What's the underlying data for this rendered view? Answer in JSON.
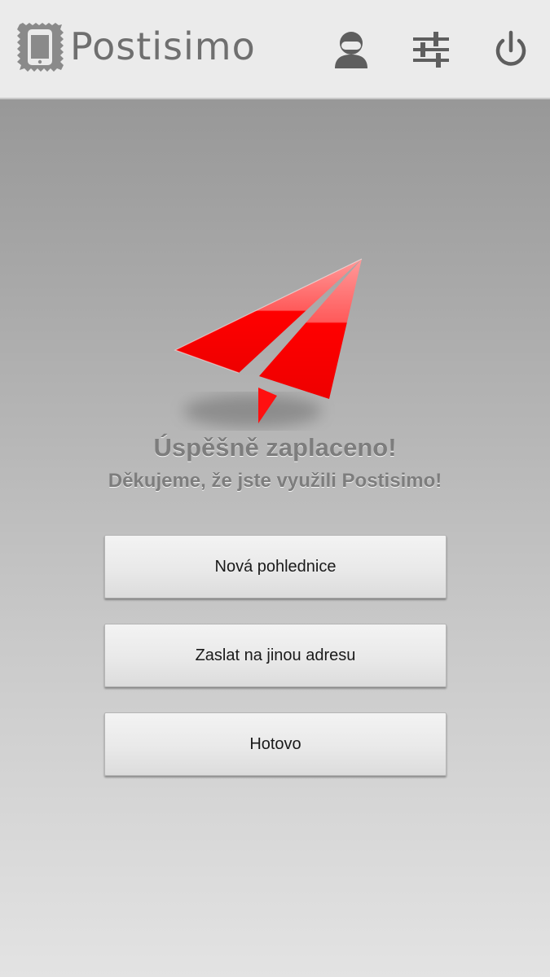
{
  "app": {
    "name": "Postisimo",
    "logo_icon": "phone-stamp-icon"
  },
  "toolbar": {
    "icons": [
      "user-icon",
      "sliders-icon",
      "power-icon"
    ]
  },
  "confirmation": {
    "illustration": "paper-plane-icon",
    "accent_color": "#ff0000",
    "title": "Úspěšně zaplaceno!",
    "subtitle": "Děkujeme, že jste využili Postisimo!"
  },
  "actions": {
    "new_postcard": "Nová pohlednice",
    "send_other_address": "Zaslat na jinou adresu",
    "done": "Hotovo"
  }
}
